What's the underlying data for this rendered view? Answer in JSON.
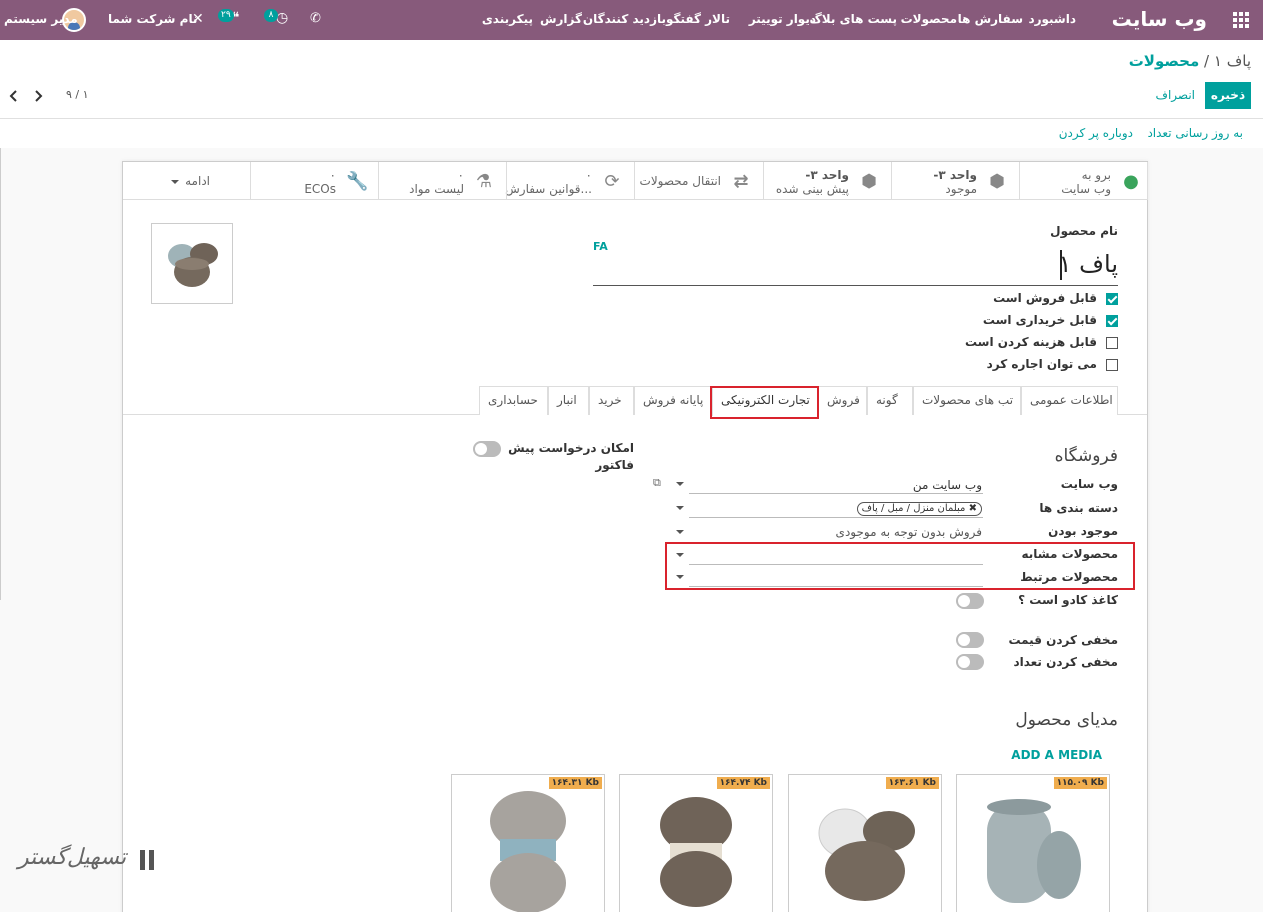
{
  "navbar": {
    "brand": "وب سایت",
    "menu": [
      "داشبورد",
      "سفارش ها",
      "محصولات",
      "پست های بلاگ",
      "دیوار توییتر",
      "تالار گفتگو",
      "بازدید کنندگان",
      "گزارش",
      "پیکربندی"
    ],
    "activity_count": "۸",
    "message_count": "۲۹",
    "company": "نام شرکت شما",
    "user": "مدیر سیستم"
  },
  "breadcrumb": {
    "parent": "محصولات",
    "separator": "/",
    "current": "پاف ۱"
  },
  "buttons": {
    "save": "ذخیره",
    "discard": "انصراف"
  },
  "pager": {
    "value": "۹ / ۱"
  },
  "actions": {
    "update_qty": "به روز رسانی تعداد",
    "replenish": "دوباره پر کردن"
  },
  "smart_buttons": {
    "website": {
      "line1": "برو به",
      "line2": "وب سایت"
    },
    "onhand": {
      "value": "-۳ واحد",
      "label": "موجود"
    },
    "forecast": {
      "value": "-۳ واحد",
      "label": "پیش بینی شده"
    },
    "moves": {
      "label": "انتقال محصولات"
    },
    "reorder": {
      "value": "۰",
      "label": "قوانین سفارش..."
    },
    "bom": {
      "value": "۰",
      "label": "لیست مواد"
    },
    "ecos": {
      "value": "۰",
      "label": "ECOs"
    },
    "more": {
      "label": "ادامه"
    }
  },
  "product": {
    "name_label": "نام محصول",
    "name": "پاف ۱",
    "lang": "FA",
    "checks": [
      {
        "label": "قابل فروش است",
        "checked": true
      },
      {
        "label": "قابل خریداری است",
        "checked": true
      },
      {
        "label": "قابل هزینه کردن است",
        "checked": false
      },
      {
        "label": "می توان اجاره کرد",
        "checked": false
      }
    ]
  },
  "tabs": [
    "اطلاعات عمومی",
    "تب های محصولات",
    "گونه",
    "فروش",
    "تجارت الکترونیکی",
    "پایانه فروش",
    "خرید",
    "انبار",
    "حسابداری"
  ],
  "active_tab": "تجارت الکترونیکی",
  "shop": {
    "title": "فروشگاه",
    "website_label": "وب سایت",
    "website_value": "وب سایت من",
    "categories_label": "دسته بندی ها",
    "category_tag": "مبلمان منزل / مبل / پاف",
    "availability_label": "موجود بودن",
    "availability_value": "فروش بدون توجه به موجودی",
    "alternative_label": "محصولات مشابه",
    "accessory_label": "محصولات مرتبط",
    "gift_label": "کاغذ کادو است ؟",
    "hide_price_label": "مخفی کردن قیمت",
    "hide_qty_label": "مخفی کردن تعداد",
    "quote_label_1": "امکان درخواست پیش",
    "quote_label_2": "فاکتور"
  },
  "media": {
    "title": "مدیای محصول",
    "add": "ADD A MEDIA",
    "sizes": [
      "۱۱۵.۰۹ Kb",
      "۱۶۳.۶۱ Kb",
      "۱۶۴.۷۴ Kb",
      "۱۶۴.۳۱ Kb"
    ]
  },
  "watermark": "تسهیل‌گستر"
}
